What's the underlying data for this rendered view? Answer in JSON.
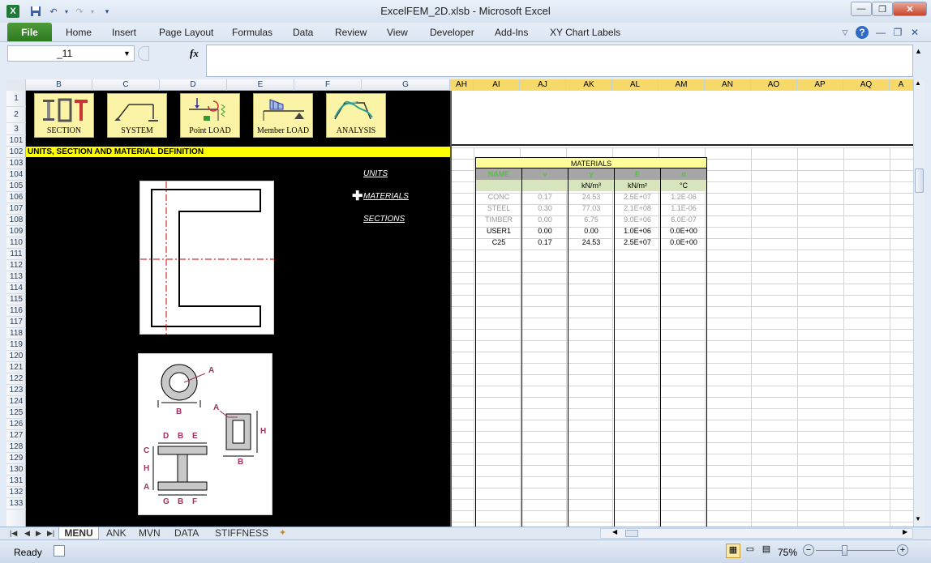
{
  "window": {
    "title": "ExcelFEM_2D.xlsb  -  Microsoft Excel"
  },
  "ribbon": {
    "file": "File",
    "tabs": [
      "Home",
      "Insert",
      "Page Layout",
      "Formulas",
      "Data",
      "Review",
      "View",
      "Developer",
      "Add-Ins",
      "XY Chart Labels"
    ]
  },
  "formula_bar": {
    "name_box": "_11",
    "fx": "fx",
    "content": ""
  },
  "columns_left": [
    "B",
    "C",
    "D",
    "E",
    "F",
    "G"
  ],
  "columns_right": [
    "AH",
    "AI",
    "AJ",
    "AK",
    "AL",
    "AM",
    "AN",
    "AO",
    "AP",
    "AQ",
    "A"
  ],
  "rows": [
    "1",
    "2",
    "3",
    "101",
    "102",
    "103",
    "104",
    "105",
    "106",
    "107",
    "108",
    "109",
    "110",
    "111",
    "112",
    "113",
    "114",
    "115",
    "116",
    "117",
    "118",
    "119",
    "120",
    "121",
    "122",
    "123",
    "124",
    "125",
    "126",
    "127",
    "128",
    "129",
    "130",
    "131",
    "132",
    "133"
  ],
  "nav_buttons": [
    "SECTION",
    "SYSTEM",
    "Point  LOAD",
    "Member LOAD",
    "ANALYSIS"
  ],
  "banner": "UNITS, SECTION AND MATERIAL DEFINITION",
  "links": [
    "UNITS",
    "MATERIALS",
    "SECTIONS"
  ],
  "section_labels": {
    "a": "A",
    "b": "B",
    "c": "C",
    "d": "D",
    "e": "E",
    "f": "F",
    "g": "G",
    "h": "H"
  },
  "materials": {
    "title": "MATERIALS",
    "header": [
      "NAME",
      "ν",
      "γ",
      "E",
      "α"
    ],
    "units": [
      "",
      "",
      "kN/m³",
      "kN/m²",
      "°C"
    ],
    "rows": [
      [
        "CONC",
        "0.17",
        "24.53",
        "2.5E+07",
        "1.2E-06"
      ],
      [
        "STEEL",
        "0.30",
        "77.03",
        "2.1E+08",
        "1.1E-06"
      ],
      [
        "TIMBER",
        "0.00",
        "6.75",
        "9.0E+06",
        "6.0E-07"
      ],
      [
        "USER1",
        "0.00",
        "0.00",
        "1.0E+06",
        "0.0E+00"
      ],
      [
        "C25",
        "0.17",
        "24.53",
        "2.5E+07",
        "0.0E+00"
      ]
    ]
  },
  "sheet_tabs": [
    "MENU",
    "ANK",
    "MVN",
    "DATA",
    "STIFFNESS"
  ],
  "status": {
    "ready": "Ready",
    "zoom": "75%"
  }
}
